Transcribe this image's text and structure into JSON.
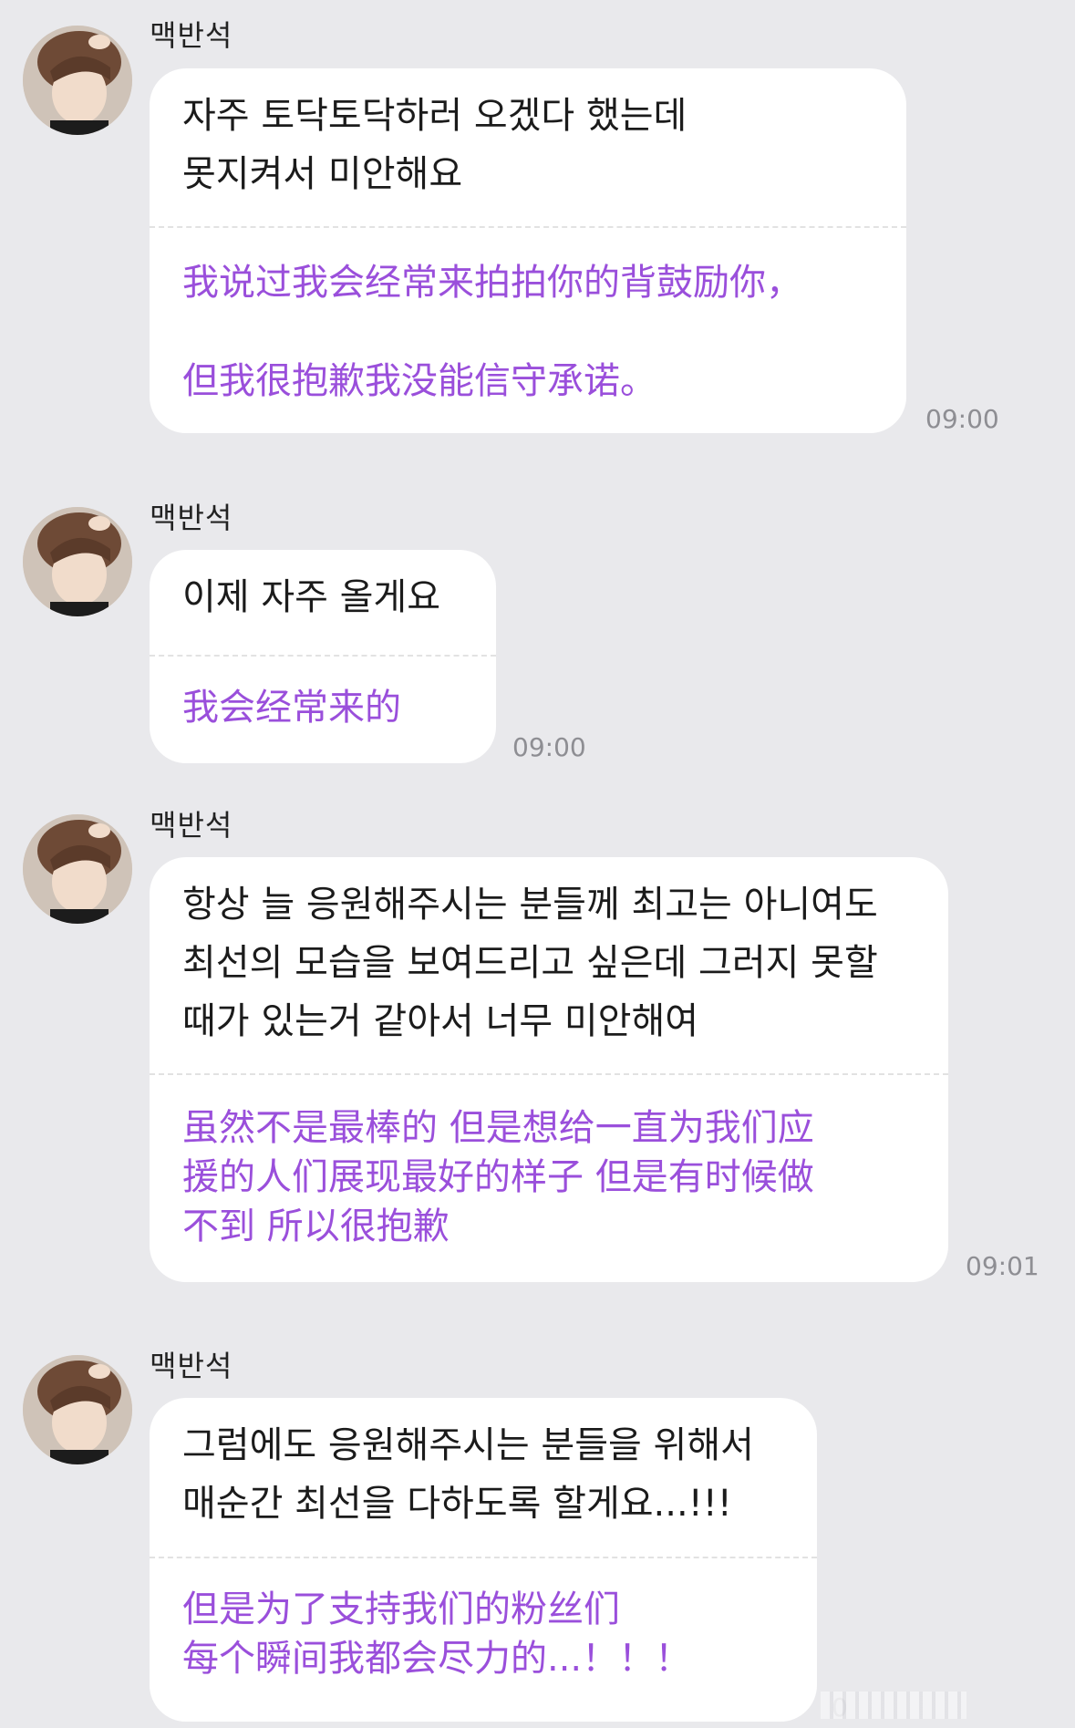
{
  "messages": [
    {
      "sender": "맥반석",
      "korean": "자주 토닥토닥하러 오겠다 했는데\n못지켜서 미안해요",
      "chinese": "我说过我会经常来拍拍你的背鼓励你，\n\n但我很抱歉我没能信守承诺。",
      "time": "09:00"
    },
    {
      "sender": "맥반석",
      "korean": "이제 자주 올게요",
      "chinese": "我会经常来的",
      "time": "09:00"
    },
    {
      "sender": "맥반석",
      "korean": "항상 늘 응원해주시는 분들께 최고는 아니여도\n최선의 모습을 보여드리고 싶은데 그러지 못할\n때가 있는거 같아서 너무 미안해여",
      "chinese": "虽然不是最棒的 但是想给一直为我们应\n援的人们展现最好的样子 但是有时候做\n不到 所以很抱歉",
      "time": "09:01"
    },
    {
      "sender": "맥반석",
      "korean": "그럼에도 응원해주시는 분들을 위해서\n매순간 최선을 다하도록 할게요...!!!",
      "chinese": "但是为了支持我们的粉丝们\n每个瞬间我都会尽力的...！！！",
      "time": "0"
    }
  ],
  "colors": {
    "background": "#e9e9ec",
    "bubble": "#ffffff",
    "translation_text": "#9a4fdb",
    "time_text": "#8e8e93"
  },
  "icons": {
    "avatar": "profile-photo-avatar"
  }
}
